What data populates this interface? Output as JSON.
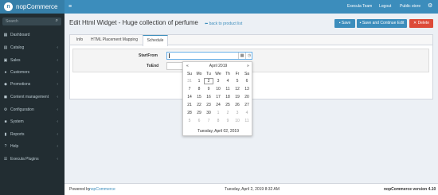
{
  "topbar": {
    "logo_text": "nopCommerce",
    "logo_mark": "n",
    "user_link": "Execula Team",
    "logout": "Logout",
    "store_link": "Public store",
    "hamburger_icon": "menu-icon",
    "gear_icon": "gear-icon"
  },
  "sidebar": {
    "search_placeholder": "Search",
    "items": [
      {
        "label": "Dashboard",
        "icon": "dashboard-icon",
        "has_children": false
      },
      {
        "label": "Catalog",
        "icon": "book-icon",
        "has_children": true
      },
      {
        "label": "Sales",
        "icon": "cart-icon",
        "has_children": true
      },
      {
        "label": "Customers",
        "icon": "users-icon",
        "has_children": true
      },
      {
        "label": "Promotions",
        "icon": "tag-icon",
        "has_children": true
      },
      {
        "label": "Content management",
        "icon": "cubes-icon",
        "has_children": true
      },
      {
        "label": "Configuration",
        "icon": "cogs-icon",
        "has_children": true
      },
      {
        "label": "System",
        "icon": "cube-icon",
        "has_children": true
      },
      {
        "label": "Reports",
        "icon": "bar-chart-icon",
        "has_children": true
      },
      {
        "label": "Help",
        "icon": "question-icon",
        "has_children": true
      },
      {
        "label": "Execula Plugins",
        "icon": "list-icon",
        "has_children": true
      }
    ]
  },
  "header": {
    "title": "Edit Html Widget - Huge collection of perfume",
    "back_link": "back to product list",
    "save": "Save",
    "save_continue": "Save and Continue Edit",
    "delete": "Delete"
  },
  "tabs": [
    "Info",
    "HTML Placement Mapping",
    "Schedule"
  ],
  "active_tab": "Schedule",
  "form": {
    "start_from_label": "StartFrom",
    "start_from_value": "",
    "to_end_label": "ToEnd",
    "to_end_value": ""
  },
  "datepicker": {
    "month_title": "April 2019",
    "prev": "«",
    "next": "»",
    "weekdays": [
      "Su",
      "Mo",
      "Tu",
      "We",
      "Th",
      "Fr",
      "Sa"
    ],
    "weeks": [
      [
        "31",
        "1",
        "2",
        "3",
        "4",
        "5",
        "6"
      ],
      [
        "7",
        "8",
        "9",
        "10",
        "11",
        "12",
        "13"
      ],
      [
        "14",
        "15",
        "16",
        "17",
        "18",
        "19",
        "20"
      ],
      [
        "21",
        "22",
        "23",
        "24",
        "25",
        "26",
        "27"
      ],
      [
        "28",
        "29",
        "30",
        "1",
        "2",
        "3",
        "4"
      ],
      [
        "5",
        "6",
        "7",
        "8",
        "9",
        "10",
        "11"
      ]
    ],
    "selected": "2",
    "footer": "Tuesday, April 02, 2019"
  },
  "footer": {
    "powered_by": "Powered by",
    "powered_link": "nopCommerce",
    "datetime": "Tuesday, April 2, 2019 8:32 AM",
    "version": "nopCommerce version 4.10"
  },
  "colors": {
    "topbar": "#3c8dbc",
    "sidebar": "#222d32",
    "danger": "#dd4b39"
  }
}
